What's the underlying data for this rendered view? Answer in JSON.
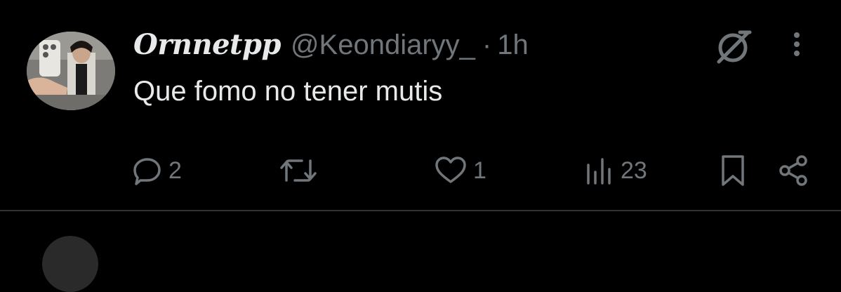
{
  "tweet": {
    "display_name": "Ornnetpp",
    "handle": "@Keondiaryy_",
    "separator": "·",
    "time": "1h",
    "text": "Que fomo no tener mutis",
    "avatar_icon": "profile-avatar"
  },
  "actions": {
    "reply": {
      "icon": "reply-icon",
      "count": "2"
    },
    "retweet": {
      "icon": "retweet-icon",
      "count": ""
    },
    "like": {
      "icon": "heart-icon",
      "count": "1"
    },
    "views": {
      "icon": "views-icon",
      "count": "23"
    },
    "bookmark": {
      "icon": "bookmark-icon"
    },
    "share": {
      "icon": "share-icon"
    }
  },
  "top_icons": {
    "grok": "grok-icon",
    "more": "more-options-icon"
  },
  "colors": {
    "background": "#000000",
    "primary_text": "#e7e9ea",
    "secondary_text": "#71767b",
    "divider": "#2f3336"
  }
}
